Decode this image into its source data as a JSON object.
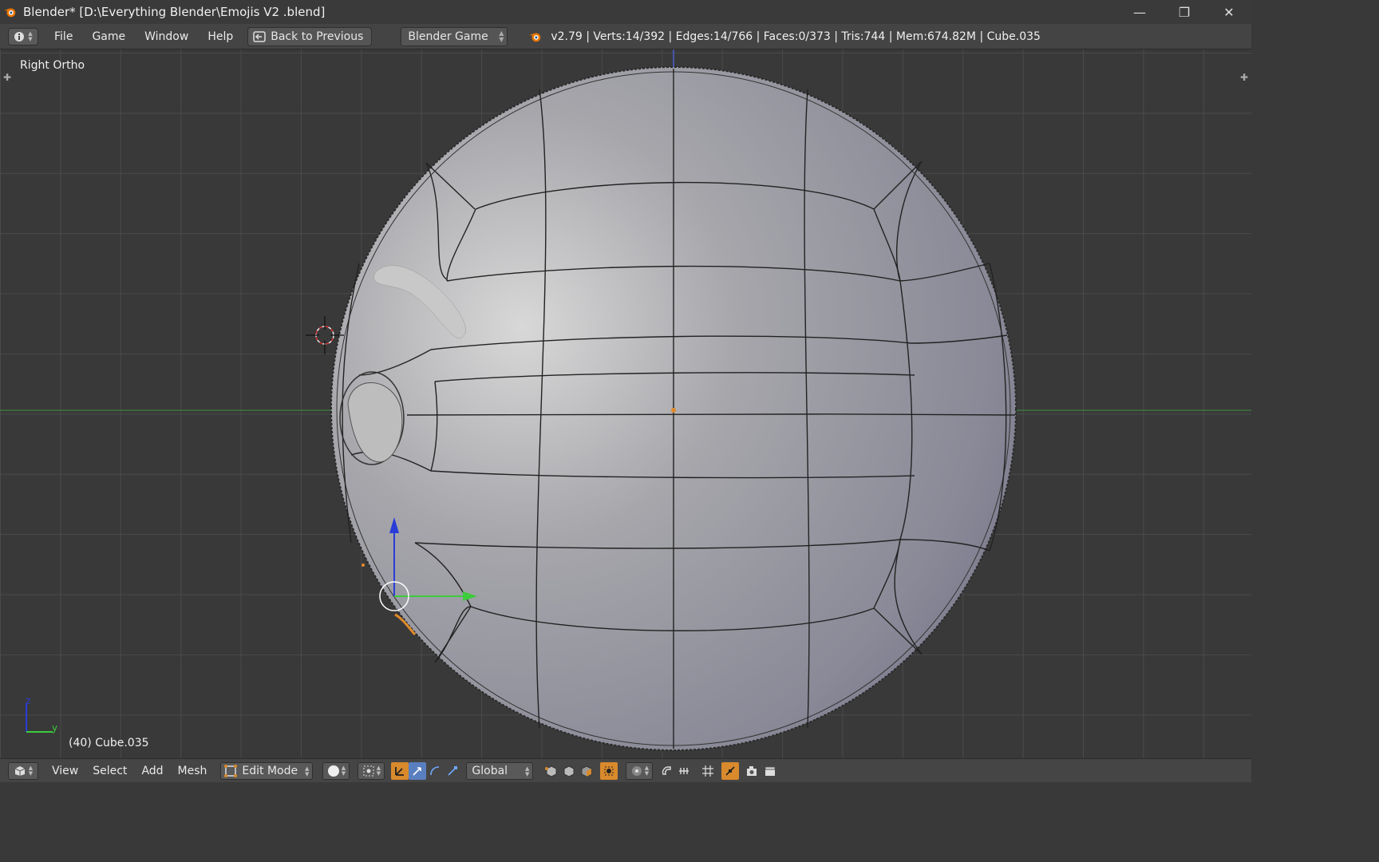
{
  "window": {
    "title": "Blender* [D:\\Everything Blender\\Emojis V2 .blend]",
    "minimize_glyph": "—",
    "restore_glyph": "❐",
    "close_glyph": "✕"
  },
  "infobar": {
    "menus": [
      "File",
      "Game",
      "Window",
      "Help"
    ],
    "back_label": "Back to Previous",
    "engine": "Blender Game",
    "stats": "v2.79 | Verts:14/392 | Edges:14/766 | Faces:0/373 | Tris:744 | Mem:674.82M | Cube.035"
  },
  "viewport": {
    "view_name": "Right Ortho",
    "object_label": "(40) Cube.035",
    "axis_z": "z",
    "axis_y": "y"
  },
  "footer": {
    "menus": [
      "View",
      "Select",
      "Add",
      "Mesh"
    ],
    "mode": "Edit Mode",
    "orientation": "Global"
  },
  "colors": {
    "accent_orange": "#d88a2c",
    "viewport_bg": "#393939",
    "grid": "#4a4a4a",
    "x_axis_green": "#3f8f3f"
  }
}
